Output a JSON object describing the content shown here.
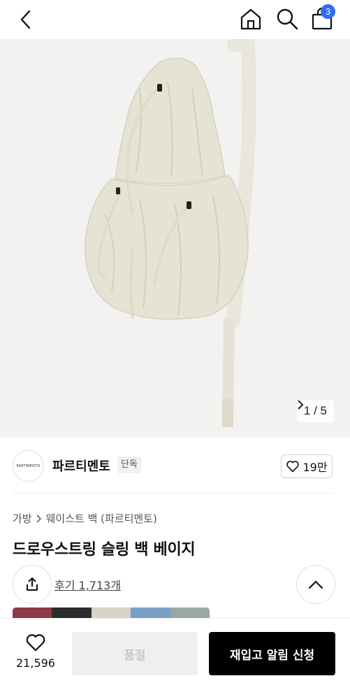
{
  "header": {
    "cart_count": "3"
  },
  "hero": {
    "pager_text": "1 / 5"
  },
  "brand": {
    "logo_text": "PARTIMENTO",
    "name": "파르티멘토",
    "tag": "단독",
    "likes": "19만"
  },
  "breadcrumb": {
    "category": "가방",
    "subcategory": "웨이스트 백 (파르티멘토)"
  },
  "product": {
    "title": "드로우스트링 슬링 백 베이지",
    "reviews": "후기 1,713개"
  },
  "bottom": {
    "like_count": "21,596",
    "soldout_label": "품절",
    "restock_label": "재입고 알림 신청"
  },
  "colors": {
    "swatches": [
      "#8c3a44",
      "#2b2b2b",
      "#d8d4c6",
      "#7aa0c8",
      "#9aa8a0"
    ],
    "accent_badge": "#2e6cf6",
    "bag_color": "#e6e3d5"
  }
}
